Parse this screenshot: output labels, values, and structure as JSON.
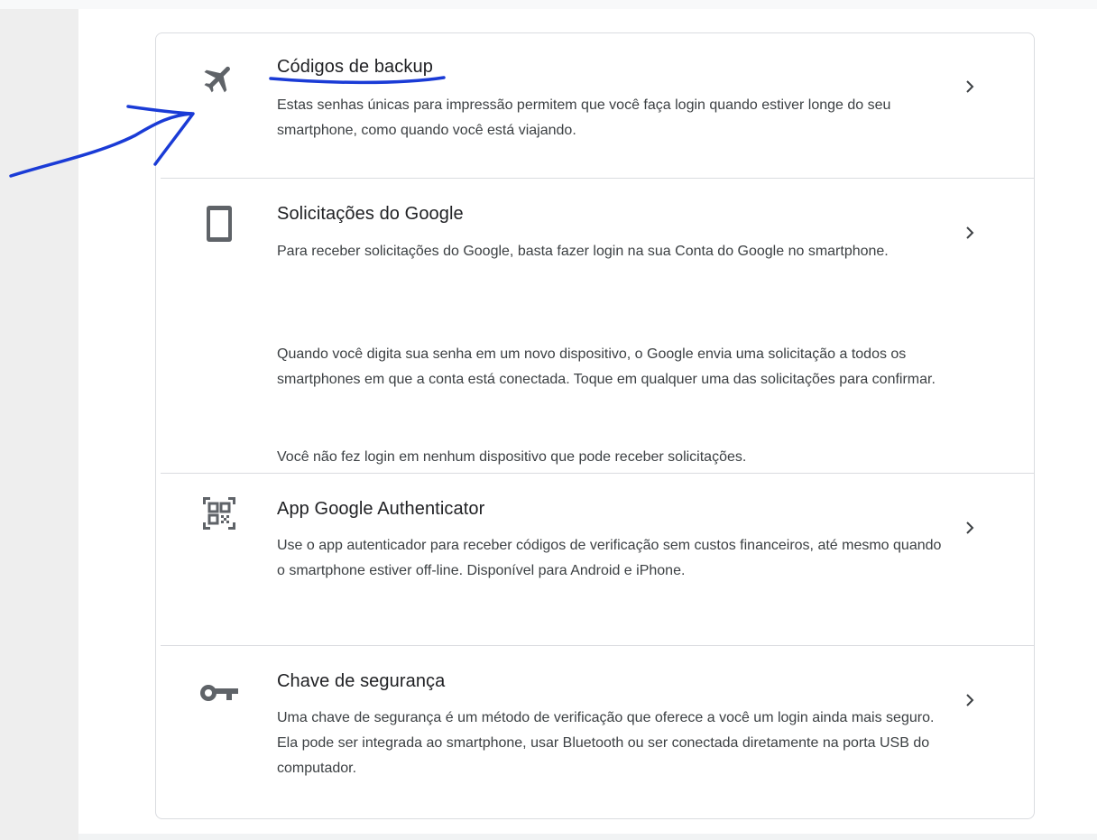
{
  "colors": {
    "icon": "#5f6368",
    "annotation": "#1a3bd6",
    "divider": "#dadce0"
  },
  "options": [
    {
      "title": "Códigos de backup",
      "description": [
        "Estas senhas únicas para impressão permitem que você faça login quando estiver longe do seu smartphone, como quando você está viajando."
      ],
      "icon": "airplane-icon"
    },
    {
      "title": "Solicitações do Google",
      "description": [
        "Para receber solicitações do Google, basta fazer login na sua Conta do Google no smartphone.",
        "Quando você digita sua senha em um novo dispositivo, o Google envia uma solicitação a todos os smartphones em que a conta está conectada. Toque em qualquer uma das solicitações para confirmar.",
        "Você não fez login em nenhum dispositivo que pode receber solicitações."
      ],
      "icon": "smartphone-icon"
    },
    {
      "title": "App Google Authenticator",
      "description": [
        "Use o app autenticador para receber códigos de verificação sem custos financeiros, até mesmo quando o smartphone estiver off-line. Disponível para Android e iPhone."
      ],
      "icon": "qr-code-icon"
    },
    {
      "title": "Chave de segurança",
      "description": [
        "Uma chave de segurança é um método de verificação que oferece a você um login ainda mais seguro. Ela pode ser integrada ao smartphone, usar Bluetooth ou ser conectada diretamente na porta USB do computador."
      ],
      "icon": "key-icon"
    }
  ]
}
